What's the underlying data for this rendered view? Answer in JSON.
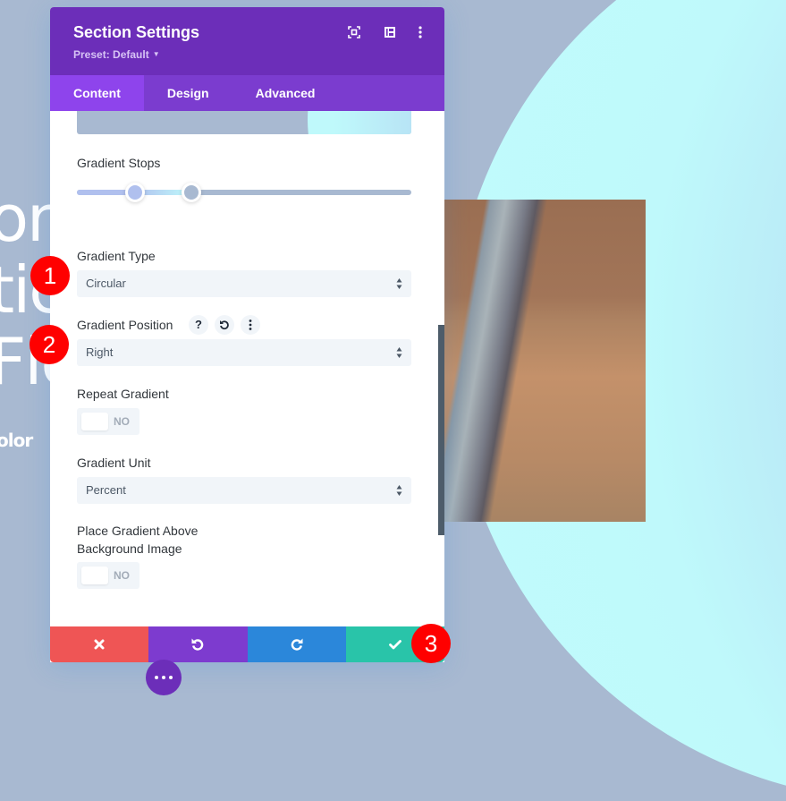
{
  "background": {
    "heading_fragments": [
      "on",
      "tic",
      "Flo"
    ],
    "subtext_fragment": "olor"
  },
  "panel": {
    "title": "Section Settings",
    "preset_label": "Preset: Default",
    "header_icons": [
      "fullscreen-icon",
      "split-view-icon",
      "more-options-icon"
    ],
    "tabs": [
      {
        "label": "Content",
        "active": true
      },
      {
        "label": "Design",
        "active": false
      },
      {
        "label": "Advanced",
        "active": false
      }
    ],
    "gradient_stops": {
      "label": "Gradient Stops",
      "stops": [
        {
          "position_percent": 17,
          "color": "#b0c0ee"
        },
        {
          "position_percent": 34,
          "color": "#a8b9d1"
        }
      ]
    },
    "gradient_type": {
      "label": "Gradient Type",
      "value": "Circular"
    },
    "gradient_position": {
      "label": "Gradient Position",
      "value": "Right",
      "help": "?",
      "reset_icon": "reset-icon",
      "menu_icon": "more-icon"
    },
    "repeat_gradient": {
      "label": "Repeat Gradient",
      "value": "NO"
    },
    "gradient_unit": {
      "label": "Gradient Unit",
      "value": "Percent"
    },
    "place_above": {
      "label_line1": "Place Gradient Above",
      "label_line2": "Background Image",
      "value": "NO"
    }
  },
  "footer": {
    "cancel_icon": "close-icon",
    "undo_icon": "undo-icon",
    "redo_icon": "redo-icon",
    "save_icon": "check-icon"
  },
  "annotations": [
    "1",
    "2",
    "3"
  ],
  "colors": {
    "header": "#6c2eb9",
    "tab_bar": "#7b3ccf",
    "tab_active": "#8e44ec",
    "cancel": "#ef5555",
    "undo": "#7d3bcf",
    "redo": "#2b87da",
    "save": "#29c4a9",
    "badge": "#ff0000"
  }
}
